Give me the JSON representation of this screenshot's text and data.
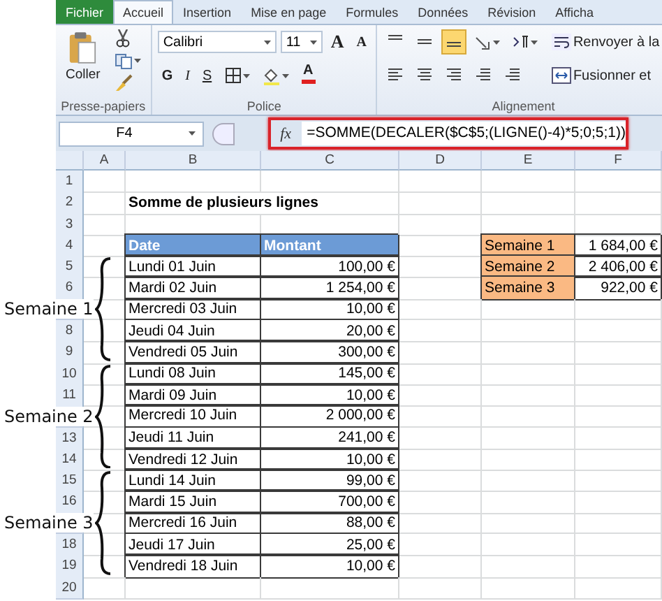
{
  "ribbon_tabs": [
    {
      "label": "Fichier",
      "kind": "file",
      "selected": false
    },
    {
      "label": "Accueil",
      "kind": "tab",
      "selected": true
    },
    {
      "label": "Insertion",
      "kind": "tab",
      "selected": false
    },
    {
      "label": "Mise en page",
      "kind": "tab",
      "selected": false
    },
    {
      "label": "Formules",
      "kind": "tab",
      "selected": false
    },
    {
      "label": "Données",
      "kind": "tab",
      "selected": false
    },
    {
      "label": "Révision",
      "kind": "tab",
      "selected": false
    },
    {
      "label": "Afficha",
      "kind": "tab",
      "selected": false
    }
  ],
  "clipboard": {
    "paste_label": "Coller",
    "group_label": "Presse-papiers"
  },
  "font": {
    "family": "Calibri",
    "size": "11",
    "size_buttons": [
      {
        "label": "A",
        "kind": "grow"
      },
      {
        "label": "A",
        "kind": "shrink"
      }
    ],
    "style_buttons": [
      {
        "label": "G",
        "kind": "bold"
      },
      {
        "label": "I",
        "kind": "italic"
      },
      {
        "label": "S",
        "kind": "underline"
      }
    ],
    "color_label": "A",
    "group_label": "Police"
  },
  "alignment": {
    "vertical_buttons": [
      {
        "kind": "top",
        "selected": false
      },
      {
        "kind": "middle",
        "selected": false
      },
      {
        "kind": "bottom",
        "selected": true
      }
    ],
    "wrap_label": "Renvoyer à la",
    "merge_label": "Fusionner et",
    "group_label": "Alignement"
  },
  "formula_bar": {
    "name_box": "F4",
    "fx": "fx",
    "formula": "=SOMME(DECALER($C$5;(LIGNE()-4)*5;0;5;1))",
    "highlighted": true
  },
  "sheet": {
    "columns": [
      "A",
      "B",
      "C",
      "D",
      "E",
      "F"
    ],
    "rows": [
      {
        "number": "1"
      },
      {
        "number": "2",
        "cells": {
          "B": {
            "text": "Somme de plusieurs lignes",
            "kind": "title"
          }
        }
      },
      {
        "number": "3"
      },
      {
        "number": "4",
        "cells": {
          "B": {
            "text": "Date",
            "kind": "header"
          },
          "C": {
            "text": "Montant",
            "kind": "header"
          },
          "E": {
            "text": "Semaine 1",
            "kind": "label"
          },
          "F": {
            "text": "1 684,00 €",
            "kind": "amount"
          }
        }
      },
      {
        "number": "5",
        "cells": {
          "B": {
            "text": "Lundi 01 Juin",
            "kind": "date"
          },
          "C": {
            "text": "100,00 €",
            "kind": "amount"
          },
          "E": {
            "text": "Semaine 2",
            "kind": "label"
          },
          "F": {
            "text": "2 406,00 €",
            "kind": "amount"
          }
        }
      },
      {
        "number": "6",
        "cells": {
          "B": {
            "text": "Mardi 02 Juin",
            "kind": "date"
          },
          "C": {
            "text": "1 254,00 €",
            "kind": "amount"
          },
          "E": {
            "text": "Semaine 3",
            "kind": "label"
          },
          "F": {
            "text": "922,00 €",
            "kind": "amount"
          }
        }
      },
      {
        "cells": {
          "B": {
            "text": "Mercredi 03 Juin",
            "kind": "date"
          },
          "C": {
            "text": "10,00 €",
            "kind": "amount"
          }
        }
      },
      {
        "number": "8",
        "cells": {
          "B": {
            "text": "Jeudi 04 Juin",
            "kind": "date"
          },
          "C": {
            "text": "20,00 €",
            "kind": "amount"
          }
        }
      },
      {
        "number": "9",
        "cells": {
          "B": {
            "text": "Vendredi 05 Juin",
            "kind": "date"
          },
          "C": {
            "text": "300,00 €",
            "kind": "amount"
          }
        }
      },
      {
        "number": "10",
        "cells": {
          "B": {
            "text": "Lundi 08 Juin",
            "kind": "date"
          },
          "C": {
            "text": "145,00 €",
            "kind": "amount"
          }
        }
      },
      {
        "number": "11",
        "cells": {
          "B": {
            "text": "Mardi 09 Juin",
            "kind": "date"
          },
          "C": {
            "text": "10,00 €",
            "kind": "amount"
          }
        }
      },
      {
        "cells": {
          "B": {
            "text": "Mercredi 10 Juin",
            "kind": "date"
          },
          "C": {
            "text": "2 000,00 €",
            "kind": "amount"
          }
        }
      },
      {
        "number": "13",
        "cells": {
          "B": {
            "text": "Jeudi 11 Juin",
            "kind": "date"
          },
          "C": {
            "text": "241,00 €",
            "kind": "amount"
          }
        }
      },
      {
        "number": "14",
        "cells": {
          "B": {
            "text": "Vendredi 12 Juin",
            "kind": "date"
          },
          "C": {
            "text": "10,00 €",
            "kind": "amount"
          }
        }
      },
      {
        "number": "15",
        "cells": {
          "B": {
            "text": "Lundi 14 Juin",
            "kind": "date"
          },
          "C": {
            "text": "99,00 €",
            "kind": "amount"
          }
        }
      },
      {
        "number": "16",
        "cells": {
          "B": {
            "text": "Mardi 15 Juin",
            "kind": "date"
          },
          "C": {
            "text": "700,00 €",
            "kind": "amount"
          }
        }
      },
      {
        "cells": {
          "B": {
            "text": "Mercredi 16 Juin",
            "kind": "date"
          },
          "C": {
            "text": "88,00 €",
            "kind": "amount"
          }
        }
      },
      {
        "number": "18",
        "cells": {
          "B": {
            "text": "Jeudi 17 Juin",
            "kind": "date"
          },
          "C": {
            "text": "25,00 €",
            "kind": "amount"
          }
        }
      },
      {
        "number": "19",
        "cells": {
          "B": {
            "text": "Vendredi 18 Juin",
            "kind": "date"
          },
          "C": {
            "text": "10,00 €",
            "kind": "amount"
          }
        }
      },
      {
        "number": "20"
      }
    ]
  },
  "annotations": [
    {
      "label": "Semaine 1"
    },
    {
      "label": "Semaine 2"
    },
    {
      "label": "Semaine 3"
    }
  ]
}
